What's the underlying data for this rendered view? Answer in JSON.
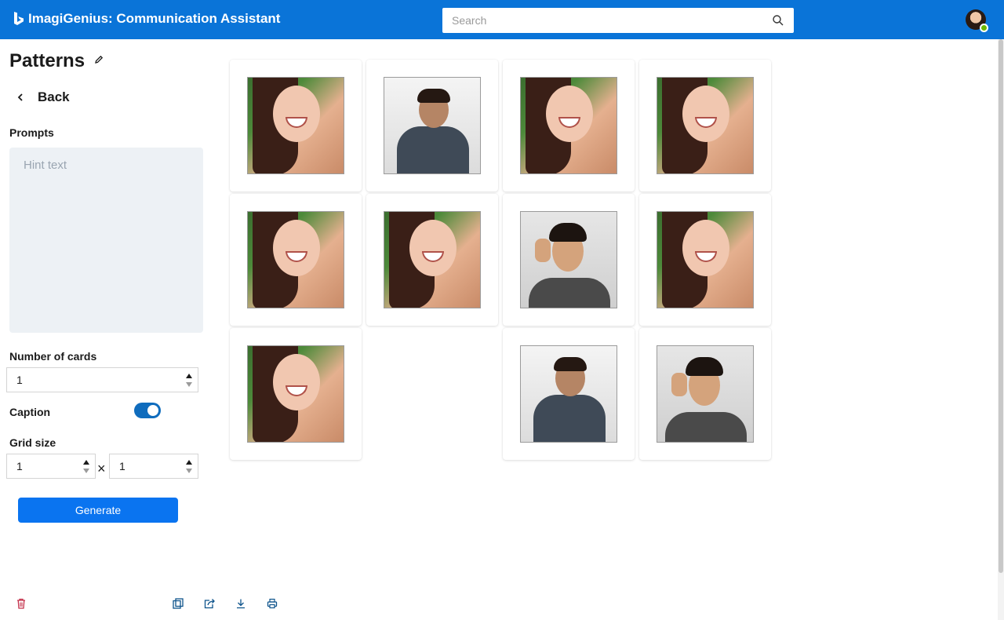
{
  "app": {
    "title": "ImagiGenius: Communication Assistant",
    "brand_color": "#0a74d8"
  },
  "search": {
    "placeholder": "Search",
    "icon": "search-icon"
  },
  "page": {
    "title": "Patterns"
  },
  "nav": {
    "back_label": "Back"
  },
  "form": {
    "prompts_label": "Prompts",
    "prompts_placeholder": "Hint text",
    "prompts_value": "",
    "number_of_cards_label": "Number of cards",
    "number_of_cards_value": "1",
    "caption_label": "Caption",
    "caption_enabled": true,
    "grid_size_label": "Grid size",
    "grid_rows_value": "1",
    "grid_cols_value": "1",
    "grid_separator": "×",
    "generate_label": "Generate"
  },
  "footer": {
    "icons": [
      "delete-icon",
      "copy-icon",
      "share-icon",
      "download-icon",
      "print-icon"
    ]
  },
  "cards": [
    {
      "image": "smiling-woman"
    },
    {
      "image": "man-covering-ears"
    },
    {
      "image": "smiling-woman"
    },
    {
      "image": "smiling-woman"
    },
    {
      "image": "smiling-woman"
    },
    {
      "image": "smiling-woman"
    },
    {
      "image": "man-thinking"
    },
    {
      "image": "smiling-woman"
    },
    {
      "image": "smiling-woman"
    },
    null,
    {
      "image": "man-covering-ears"
    },
    {
      "image": "man-thinking"
    }
  ]
}
